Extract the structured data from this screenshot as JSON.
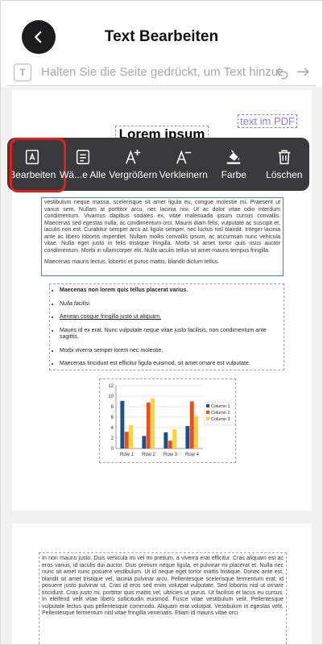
{
  "header": {
    "title": "Text Bearbeiten"
  },
  "hint_bar": {
    "text": "Halten Sie die Seite gedrückt, um Text hinzuzufügen"
  },
  "toolbar": {
    "items": [
      {
        "label": "Bearbeiten",
        "icon": "edit-text-icon",
        "selected": true
      },
      {
        "label": "Wä...e Alle",
        "icon": "select-all-icon"
      },
      {
        "label": "Vergrößern",
        "icon": "text-enlarge-icon"
      },
      {
        "label": "Verkleinern",
        "icon": "text-shrink-icon"
      },
      {
        "label": "Farbe",
        "icon": "paint-bucket-icon"
      },
      {
        "label": "Löschen",
        "icon": "trash-icon"
      }
    ],
    "selected_outline_color": "#e81b1b"
  },
  "document": {
    "heading": "Lorem ipsum",
    "added_text": "text im PDF",
    "paragraph": "vestibulum neque massa, scelerisque sit amet ligula eu, congue molestie mi. Praesent ut varius sem. Nullam at porttitor arcu, nec lacinia nisi. Ut ac dolor vitae odio interdum condimentum. Vivamus dapibus sodales ex, vitae malesuada ipsum cursus convallis. Maecenas sed egestas nulla, ac condimentum orci. Mauris diam felis, vulputate ac suscipit et, iaculis non est. Curabitur semper arcu ac ligula semper, nec luctus nisl blandit. Integer lacinia ante ac libero lobortis imperdiet. Nullam mollis convallis ipsum, ac accumsan nunc vehicula vitae. Nulla eget justo in felis tristique fringilla. Morbi sit amet tortor quis risus auctor condimentum. Morbi in ullamcorper elit. Nulla iaculis tellus sit amet mauris tempus fringilla.",
    "paragraph2": "Maecenas mauris lectus, lobortis et purus mattis, blandit dictum tellus.",
    "list": [
      "Maecenas non lorem quis tellus placerat varius.",
      "Nulla facilisi.",
      "Aenean congue fringilla justo ut aliquam.",
      "Mauris id ex erat. Nunc vulputate neque vitae justo facilisis, non condimentum ante sagittis.",
      "Morbi viverra semper lorem nec molestie.",
      "Maecenas tincidunt est efficitur ligula euismod, sit amet ornare est vulputate."
    ],
    "page2_text": "In non mauris justo. Duis vehicula mi vel mi pretium, a viverra erat efficitur. Cras aliquam est ac eros varius, id iaculis dui auctor. Duis pretium neque ligula, et pulvinar mi placerat et. Nulla nec nunc sit amet nunc posuere vestibulum. Ut id neque eget tortor mattis tristique. Donec ante est, blandit sit amet tristique vel, lacinia pulvinar arcu. Pellentesque scelerisque fermentum erat, id posuere justo pulvinar ut. Cras id eros sed enim volutpat vulputate. Sed lobortis nisl ut ornare tincidunt. Cras justo mi, porttitor quis mattis vel, ultricies ut purus. Ut facilisis et lacus eu cursus. In eleifend velit vitae libero sollicitudin euismod. Fusce vitae vestibulum velit. Pellentesque vulputate lectus quis pellentesque commodo. Aliquam erat volutpat. Vestibulum in egestas velit. Pellentesque fermentum nisl vitae fringilla venenatis. Etiam id mauris vitae orci"
  },
  "chart_data": {
    "type": "bar",
    "categories": [
      "Row 1",
      "Row 2",
      "Row 3",
      "Row 4"
    ],
    "series": [
      {
        "name": "Column 1",
        "values": [
          9.1,
          2.4,
          3.1,
          4.3
        ],
        "color": "#1f4e8c"
      },
      {
        "name": "Column 2",
        "values": [
          3.2,
          8.8,
          1.5,
          9.0
        ],
        "color": "#e8501c"
      },
      {
        "name": "Column 3",
        "values": [
          4.5,
          9.6,
          3.7,
          6.2
        ],
        "color": "#ffd33e"
      }
    ],
    "ylim": [
      0,
      12
    ],
    "yticks": [
      0,
      2,
      4,
      6,
      8,
      10,
      12
    ],
    "legend": "right",
    "grid": true
  }
}
